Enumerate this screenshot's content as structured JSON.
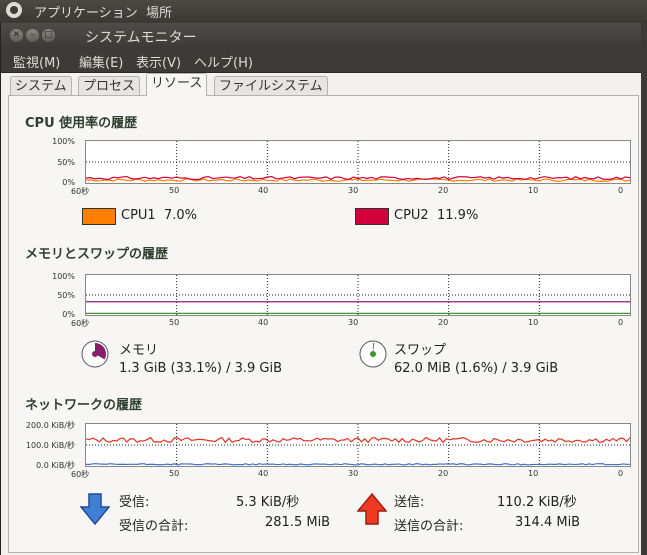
{
  "top_panel": {
    "items": [
      "アプリケーション",
      "場所"
    ]
  },
  "window": {
    "title": "システムモニター"
  },
  "menu": [
    "監視(M)",
    "編集(E)",
    "表示(V)",
    "ヘルプ(H)"
  ],
  "tabs": [
    "システム",
    "プロセス",
    "リソース",
    "ファイルシステム"
  ],
  "active_tab": "リソース",
  "cpu": {
    "title": "CPU 使用率の履歴",
    "y_ticks": [
      "100%",
      "50%",
      "0%"
    ],
    "x_ticks": [
      "60秒",
      "50",
      "40",
      "30",
      "20",
      "10",
      "0"
    ],
    "legend": [
      {
        "label": "CPU1",
        "value": "7.0%",
        "color": "#ff7f00"
      },
      {
        "label": "CPU2",
        "value": "11.9%",
        "color": "#d0003a"
      }
    ]
  },
  "memory": {
    "title": "メモリとスワップの履歴",
    "y_ticks": [
      "100%",
      "50%",
      "0%"
    ],
    "x_ticks": [
      "60秒",
      "50",
      "40",
      "30",
      "20",
      "10",
      "0"
    ],
    "mem_label": "メモリ",
    "mem_value": "1.3 GiB (33.1%) / 3.9 GiB",
    "mem_fraction": 0.331,
    "mem_color": "#8b1e6b",
    "swap_label": "スワップ",
    "swap_value": "62.0 MiB (1.6%) / 3.9 GiB",
    "swap_fraction": 0.016,
    "swap_color": "#3a9b2a"
  },
  "network": {
    "title": "ネットワークの履歴",
    "y_ticks": [
      "200.0 KiB/秒",
      "100.0 KiB/秒",
      "0.0 KiB/秒"
    ],
    "x_ticks": [
      "60秒",
      "50",
      "40",
      "30",
      "20",
      "10",
      "0"
    ],
    "recv_label": "受信:",
    "recv_value": "5.3 KiB/秒",
    "recv_total_label": "受信の合計:",
    "recv_total_value": "281.5 MiB",
    "send_label": "送信:",
    "send_value": "110.2 KiB/秒",
    "send_total_label": "送信の合計:",
    "send_total_value": "314.4 MiB",
    "recv_color": "#3f6fcf",
    "send_color": "#e2321f"
  }
}
